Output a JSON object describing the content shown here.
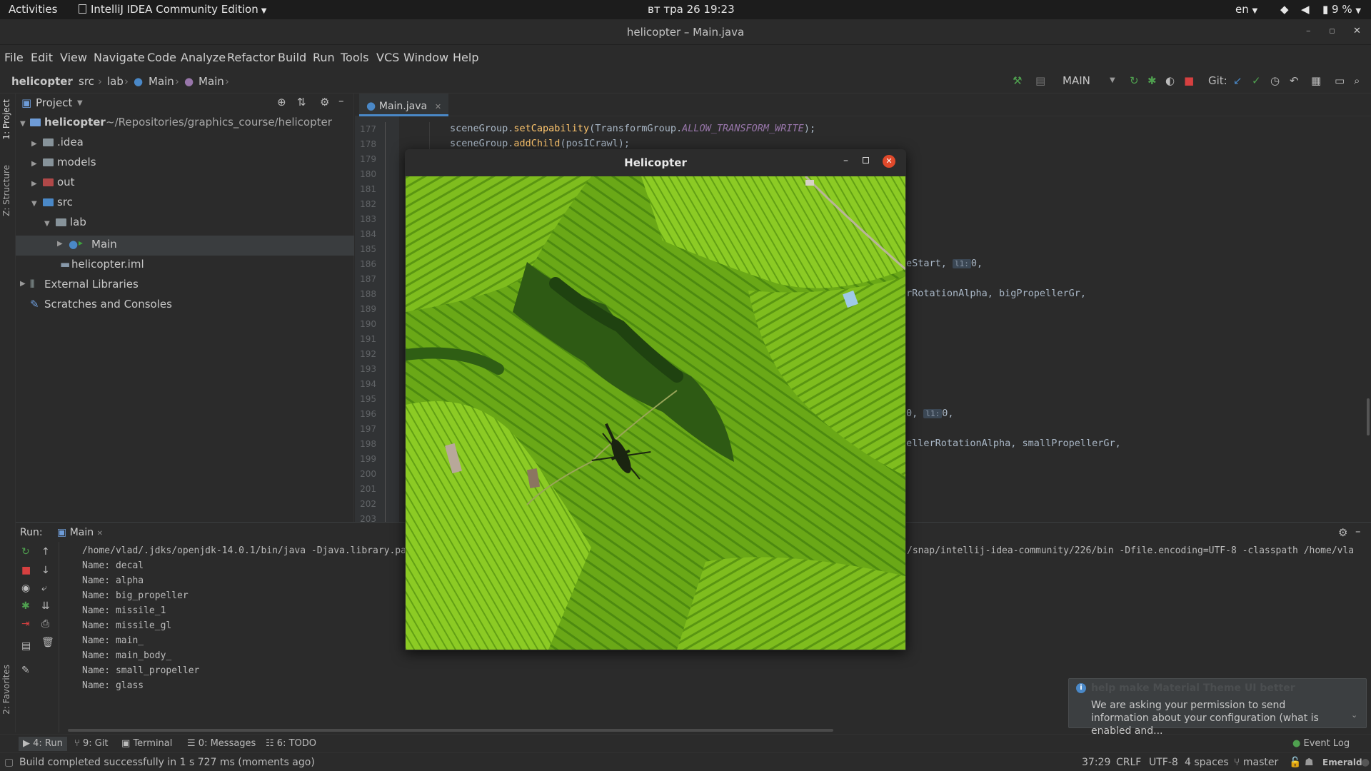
{
  "topbar": {
    "activities": "Activities",
    "app_menu": "IntelliJ IDEA Community Edition",
    "clock": "вт тра 26  19:23",
    "lang": "en",
    "battery": "9 %"
  },
  "window": {
    "title": "helicopter – Main.java"
  },
  "menu": [
    "File",
    "Edit",
    "View",
    "Navigate",
    "Code",
    "Analyze",
    "Refactor",
    "Build",
    "Run",
    "Tools",
    "VCS",
    "Window",
    "Help"
  ],
  "breadcrumb": [
    "helicopter",
    "src",
    "lab",
    "Main",
    "Main"
  ],
  "toolbar": {
    "run_config": "MAIN",
    "git_label": "Git:"
  },
  "sidebar_tabs": {
    "project": "1: Project",
    "structure": "Z: Structure",
    "favorites": "2: Favorites"
  },
  "project": {
    "header": "Project",
    "root_name": "helicopter",
    "root_path": "~/Repositories/graphics_course/helicopter",
    "items": [
      ".idea",
      "models",
      "out",
      "src",
      "lab",
      "Main",
      "helicopter.iml",
      "External Libraries",
      "Scratches and Consoles"
    ]
  },
  "editor": {
    "tab": "Main.java",
    "line_numbers": [
      "177",
      "178",
      "179",
      "180",
      "181",
      "182",
      "183",
      "184",
      "185",
      "186",
      "187",
      "188",
      "189",
      "190",
      "191",
      "192",
      "193",
      "194",
      "195",
      "196",
      "197",
      "198",
      "199",
      "200",
      "201",
      "202",
      "203"
    ],
    "line177": {
      "a": "sceneGroup.",
      "m": "setCapability",
      "b": "(TransformGroup.",
      "c": "ALLOW_TRANSFORM_WRITE",
      "d": ");"
    },
    "line178": {
      "a": "sceneGroup.",
      "m": "addChild",
      "b": "(posICrawl);"
    },
    "frag186": "eStart, ",
    "frag186_hint": "l1:",
    "frag186_tail": "0,",
    "frag188": "rRotationAlpha, bigPropellerGr,",
    "frag196_a": "0, ",
    "frag196_hint": "l1:",
    "frag196_tail": "0,",
    "frag198": "ellerRotationAlpha, smallPropellerGr,"
  },
  "run": {
    "label": "Run:",
    "tab": "Main",
    "cmd": "/home/vlad/.jdks/openjdk-14.0.1/bin/java -Djava.library.pat",
    "cmd_tail": "/snap/intellij-idea-community/226/bin -Dfile.encoding=UTF-8 -classpath /home/vla",
    "output": [
      "Name: decal",
      "Name: alpha",
      "Name: big_propeller",
      "Name: missile_1",
      "Name: missile_gl",
      "Name: main_",
      "Name: main_body_",
      "Name: small_propeller",
      "Name: glass"
    ]
  },
  "bottom_tabs": [
    "4: Run",
    "9: Git",
    "Terminal",
    "0: Messages",
    "6: TODO"
  ],
  "event_log": "Event Log",
  "status": {
    "message": "Build completed successfully in 1 s 727 ms (moments ago)",
    "position": "37:29",
    "line_sep": "CRLF",
    "encoding": "UTF-8",
    "indent": "4 spaces",
    "branch": "master",
    "theme": "Emerald"
  },
  "helicopter_window": {
    "title": "Helicopter"
  },
  "notification": {
    "title": "help make Material Theme UI better",
    "body": "We are asking your permission to send information about your configuration (what is enabled and..."
  },
  "colors": {
    "accent": "#4a88c7",
    "keyword": "#cc7832",
    "method": "#ffc66d",
    "field": "#9876aa",
    "field_purple": "#9876aa",
    "close_red": "#e0492b"
  }
}
